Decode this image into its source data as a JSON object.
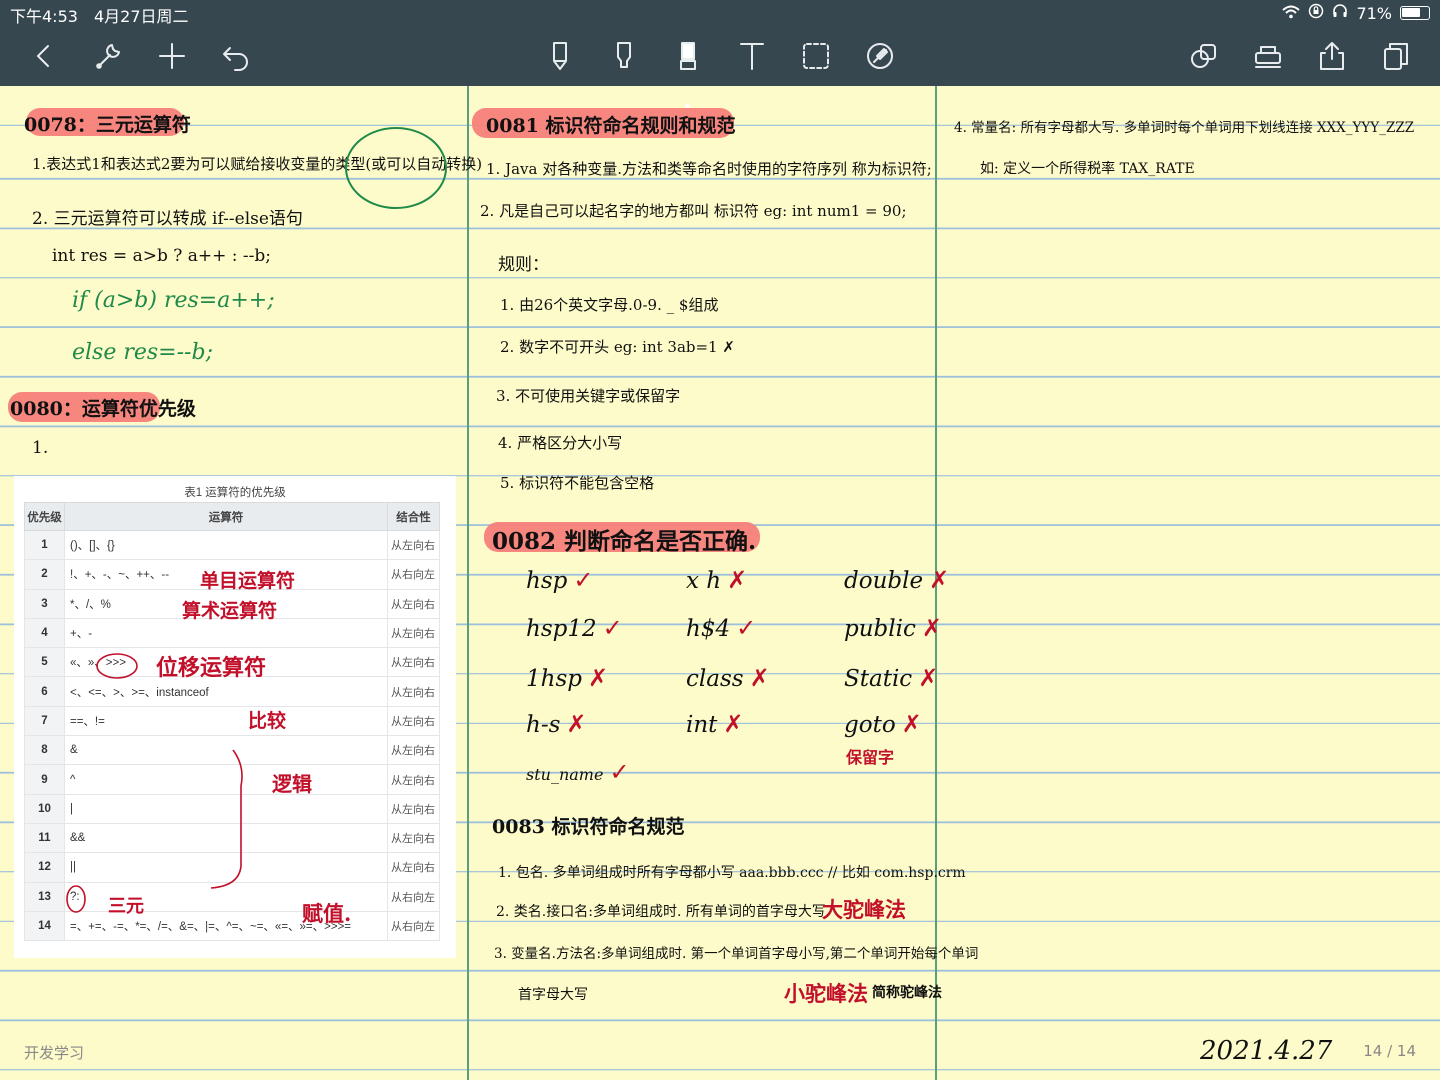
{
  "status": {
    "time": "下午4:53",
    "date": "4月27日周二",
    "battery": "71%",
    "battery_level": 0.71
  },
  "toolbar": {
    "icons": [
      "chevron-left-icon",
      "wrench-icon",
      "plus-icon",
      "undo-icon",
      "pen-icon",
      "highlighter-icon",
      "marker-icon",
      "text-icon",
      "lasso-icon",
      "eraser-icon",
      "shapes-icon",
      "stamp-icon",
      "share-icon",
      "pages-icon"
    ],
    "active": "marker-icon"
  },
  "col1": {
    "h1": "0078：三元运算符",
    "l1": "1.表达式1和表达式2要为可以赋给接收变量的类型(或可以自动转换)",
    "l2": "2. 三元运算符可以转成 if--else语句",
    "code1": "int  res = a>b ?  a++ :  --b;",
    "code2": "if  (a>b)  res=a++;",
    "code3": "else    res=--b;",
    "h2": "0080：运算符优先级",
    "l3": "1.",
    "table": {
      "caption": "表1 运算符的优先级",
      "headers": [
        "优先级",
        "运算符",
        "结合性"
      ],
      "rows": [
        [
          "1",
          "()、[]、{}",
          "从左向右"
        ],
        [
          "2",
          "!、+、-、~、++、--",
          "从右向左"
        ],
        [
          "3",
          "*、/、%",
          "从左向右"
        ],
        [
          "4",
          "+、-",
          "从左向右"
        ],
        [
          "5",
          "«、»、>>>",
          "从左向右"
        ],
        [
          "6",
          "<、<=、>、>=、instanceof",
          "从左向右"
        ],
        [
          "7",
          "==、!=",
          "从左向右"
        ],
        [
          "8",
          "&",
          "从左向右"
        ],
        [
          "9",
          "^",
          "从左向右"
        ],
        [
          "10",
          "|",
          "从左向右"
        ],
        [
          "11",
          "&&",
          "从左向右"
        ],
        [
          "12",
          "||",
          "从左向右"
        ],
        [
          "13",
          "?:",
          "从右向左"
        ],
        [
          "14",
          "=、+=、-=、*=、/=、&=、|=、^=、~=、«=、»=、>>>=",
          "从右向左"
        ]
      ]
    },
    "ann1": "单目运算符",
    "ann2": "算术运算符",
    "ann3": "位移运算符",
    "ann4": "比较",
    "ann5": "逻辑",
    "ann6": "三元",
    "ann7": "赋值."
  },
  "col2": {
    "h1": "0081  标识符命名规则和规范",
    "l1": "1. Java 对各种变量.方法和类等命名时使用的字符序列 称为标识符;",
    "l2": "2. 凡是自己可以起名字的地方都叫 标识符  eg: int num1 = 90;",
    "l3": "规则：",
    "r1": "1. 由26个英文字母.0-9. _ $组成",
    "r2": "2. 数字不可开头   eg: int 3ab=1 ✗",
    "r3": "3. 不可使用关键字或保留字",
    "r4": "4. 严格区分大小写",
    "r5": "5.  标识符不能包含空格",
    "h2": "0082  判断命名是否正确.",
    "names": [
      {
        "name": "hsp",
        "mark": "✓"
      },
      {
        "name": "x h",
        "mark": "✗"
      },
      {
        "name": "double",
        "mark": "✗"
      },
      {
        "name": "hsp12",
        "mark": "✓"
      },
      {
        "name": "h$4",
        "mark": "✓"
      },
      {
        "name": "public",
        "mark": "✗"
      },
      {
        "name": "1hsp",
        "mark": "✗"
      },
      {
        "name": "class",
        "mark": "✗"
      },
      {
        "name": "Static",
        "mark": "✗"
      },
      {
        "name": "h-s",
        "mark": "✗"
      },
      {
        "name": "int",
        "mark": "✗"
      },
      {
        "name": "goto",
        "mark": "✗"
      },
      {
        "name": "stu_name",
        "mark": "✓"
      }
    ],
    "goto_note": "保留字",
    "h3": "0083  标识符命名规范",
    "n1": "1. 包名. 多单词组成时所有字母都小写  aaa.bbb.ccc // 比如 com.hsp.crm",
    "n2": "2. 类名.接口名:多单词组成时. 所有单词的首字母大写",
    "n2b": "大驼峰法",
    "n3": "3. 变量名.方法名:多单词组成时. 第一个单词首字母小写,第二个单词开始每个单词",
    "n3b": "首字母大写",
    "n3c": "小驼峰法",
    "n3d": "简称驼峰法"
  },
  "col3": {
    "l1": "4. 常量名: 所有字母都大写. 多单词时每个单词用下划线连接  XXX_YYY_ZZZ",
    "l2": "如: 定义一个所得税率  TAX_RATE"
  },
  "footer": {
    "notebook": "开发学习",
    "date": "2021.4.27",
    "pages": "14 / 14"
  }
}
